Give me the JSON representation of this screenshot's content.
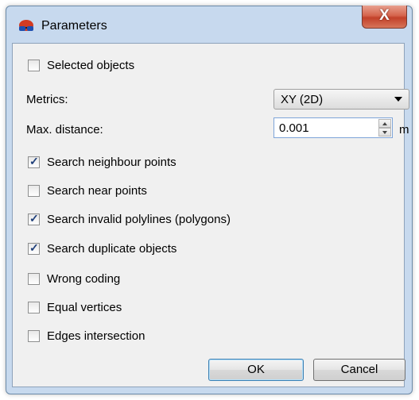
{
  "window": {
    "title": "Parameters",
    "close_label": "X"
  },
  "form": {
    "selected_objects": {
      "label": "Selected objects",
      "checked": false
    },
    "metrics": {
      "label": "Metrics:",
      "value": "XY (2D)"
    },
    "max_distance": {
      "label": "Max. distance:",
      "value": "0.001",
      "unit": "m"
    },
    "options": [
      {
        "label": "Search neighbour points",
        "checked": true
      },
      {
        "label": "Search near points",
        "checked": false
      },
      {
        "label": "Search invalid polylines (polygons)",
        "checked": true
      },
      {
        "label": "Search duplicate objects",
        "checked": true
      },
      {
        "label": "Wrong coding",
        "checked": false
      },
      {
        "label": "Equal vertices",
        "checked": false
      },
      {
        "label": "Edges intersection",
        "checked": false
      }
    ]
  },
  "buttons": {
    "ok": "OK",
    "cancel": "Cancel"
  },
  "colors": {
    "title_bar": "#c7d9ee",
    "close_button": "#c7442c",
    "client_bg": "#f0f0f0",
    "check_mark": "#1f3f7a"
  }
}
